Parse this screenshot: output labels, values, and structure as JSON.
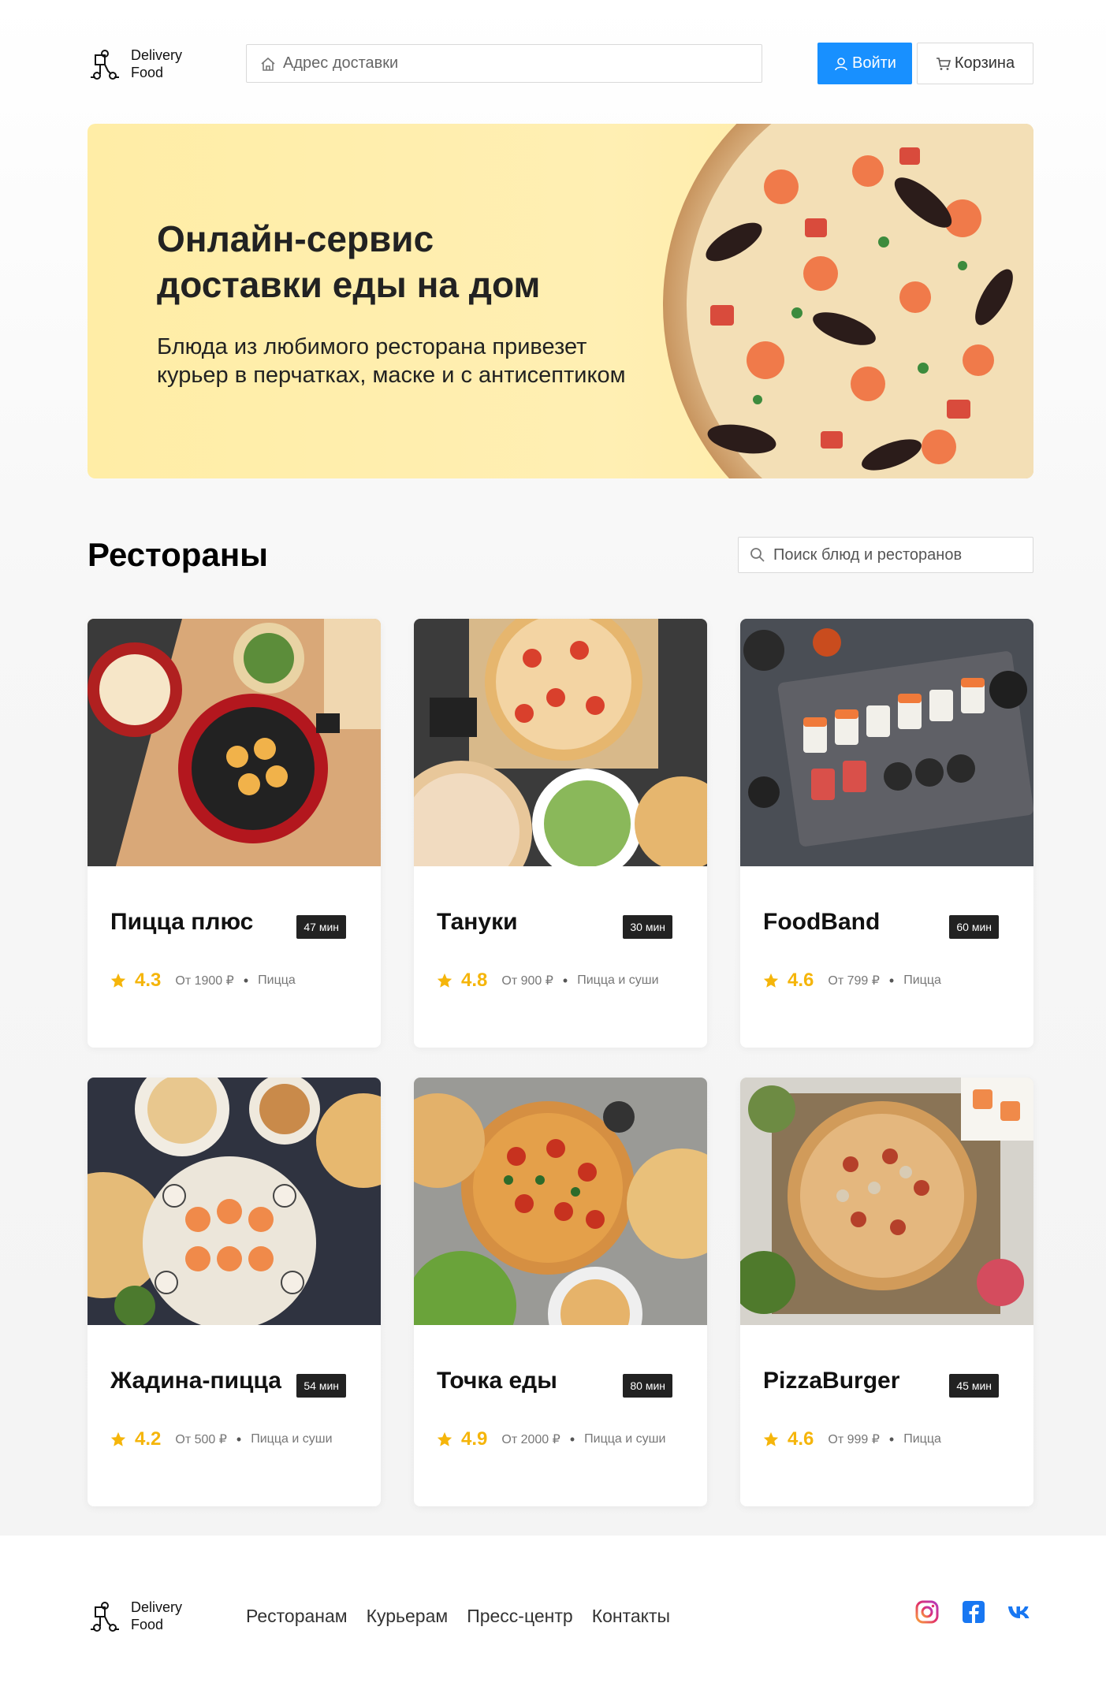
{
  "header": {
    "logo_line1": "Delivery",
    "logo_line2": "Food",
    "address_placeholder": "Адрес доставки",
    "login_label": "Войти",
    "cart_label": "Корзина"
  },
  "promo": {
    "title_line1": "Онлайн-сервис",
    "title_line2": "доставки еды на дом",
    "text_line1": "Блюда из любимого ресторана привезет",
    "text_line2": "курьер в перчатках, маске и с антисептиком"
  },
  "restaurants": {
    "title": "Рестораны",
    "search_placeholder": "Поиск блюд и ресторанов",
    "items": [
      {
        "name": "Пицца плюс",
        "time": "47 мин",
        "rating": "4.3",
        "price": "От 1900 ₽",
        "category": "Пицца"
      },
      {
        "name": "Тануки",
        "time": "30 мин",
        "rating": "4.8",
        "price": "От 900 ₽",
        "category": "Пицца и суши"
      },
      {
        "name": "FoodBand",
        "time": "60 мин",
        "rating": "4.6",
        "price": "От 799 ₽",
        "category": "Пицца"
      },
      {
        "name": "Жадина-пицца",
        "time": "54 мин",
        "rating": "4.2",
        "price": "От 500 ₽",
        "category": "Пицца и суши"
      },
      {
        "name": "Точка еды",
        "time": "80 мин",
        "rating": "4.9",
        "price": "От 2000 ₽",
        "category": "Пицца и суши"
      },
      {
        "name": "PizzaBurger",
        "time": "45 мин",
        "rating": "4.6",
        "price": "От 999 ₽",
        "category": "Пицца"
      }
    ]
  },
  "footer": {
    "logo_line1": "Delivery",
    "logo_line2": "Food",
    "nav": [
      "Ресторанам",
      "Курьерам",
      "Пресс-центр",
      "Контакты"
    ],
    "social": [
      "instagram-icon",
      "facebook-icon",
      "vk-icon"
    ]
  },
  "colors": {
    "accent": "#1890ff",
    "rating": "#f5b50a",
    "promo_bg": "#ffeda6",
    "badge_bg": "#222222"
  }
}
